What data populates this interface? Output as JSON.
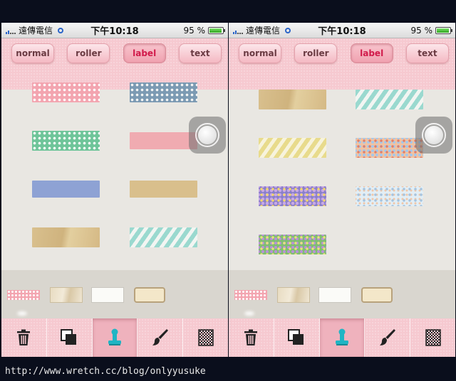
{
  "screens": [
    {
      "status": {
        "carrier": "遠傳電信",
        "time": "下午10:18",
        "battery": "95 %"
      },
      "tabs": [
        {
          "label": "normal",
          "active": false
        },
        {
          "label": "roller",
          "active": false
        },
        {
          "label": "label",
          "active": true
        },
        {
          "label": "text",
          "active": false
        }
      ],
      "tapes": [
        "pink polka dot",
        "blue polka dot",
        "green polka dot",
        "pink solid",
        "blue solid",
        "kraft",
        "kraft torn",
        "mint stripe"
      ],
      "tray": [
        "pink polka dot",
        "paper",
        "white",
        "frame"
      ],
      "tools": [
        {
          "icon": "trash-icon",
          "active": false
        },
        {
          "icon": "layers-icon",
          "active": false
        },
        {
          "icon": "stamp-icon",
          "active": true
        },
        {
          "icon": "brush-icon",
          "active": false
        },
        {
          "icon": "pattern-icon",
          "active": false
        }
      ]
    },
    {
      "status": {
        "carrier": "遠傳電信",
        "time": "下午10:18",
        "battery": "95 %"
      },
      "tabs": [
        {
          "label": "normal",
          "active": false
        },
        {
          "label": "roller",
          "active": false
        },
        {
          "label": "label",
          "active": true
        },
        {
          "label": "text",
          "active": false
        }
      ],
      "tapes": [
        "kraft torn",
        "mint stripe",
        "yellow stripe",
        "orange floral",
        "purple floral",
        "light floral",
        "green floral"
      ],
      "tray": [
        "pink polka dot",
        "paper",
        "white",
        "frame"
      ],
      "tools": [
        {
          "icon": "trash-icon",
          "active": false
        },
        {
          "icon": "layers-icon",
          "active": false
        },
        {
          "icon": "stamp-icon",
          "active": true
        },
        {
          "icon": "brush-icon",
          "active": false
        },
        {
          "icon": "pattern-icon",
          "active": false
        }
      ]
    }
  ],
  "watermark": "http://www.wretch.cc/blog/onlyyusuke",
  "colors": {
    "accent": "#d11a4a",
    "tab_bg": "#f6c9d0",
    "canvas": "#e9e7e2",
    "stamp": "#1fb5c4"
  }
}
